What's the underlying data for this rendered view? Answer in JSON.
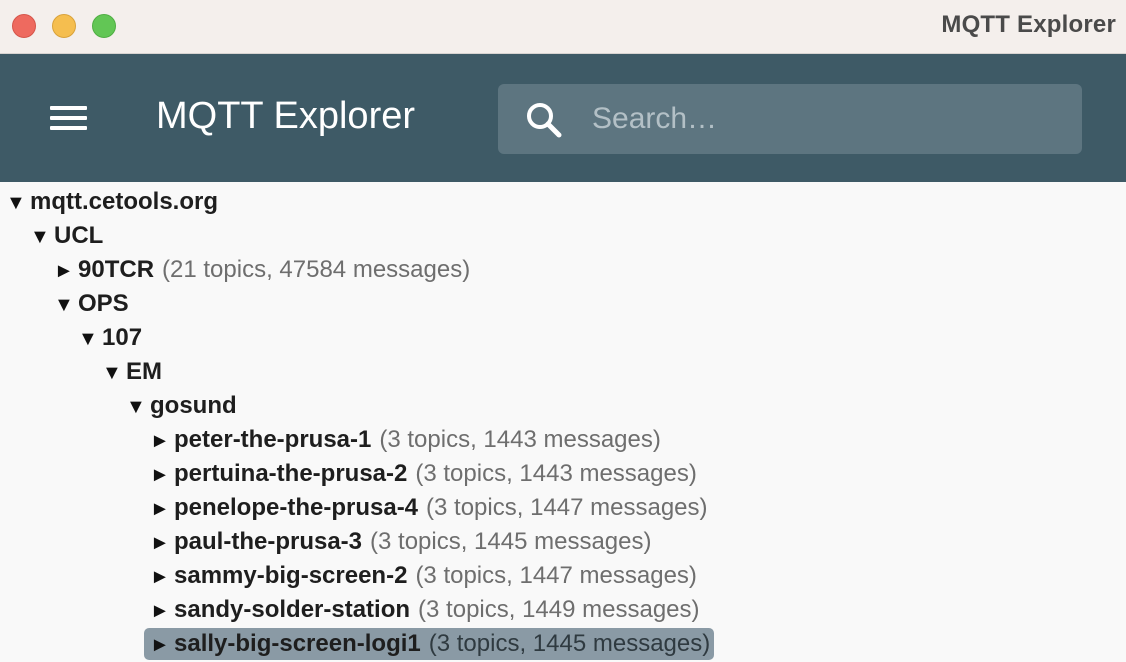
{
  "window": {
    "title": "MQTT Explorer"
  },
  "appbar": {
    "title": "MQTT Explorer",
    "search_placeholder": "Search…"
  },
  "tree": [
    {
      "label": "mqtt.cetools.org",
      "meta": "",
      "expanded": true,
      "selected": false
    },
    {
      "label": "UCL",
      "meta": "",
      "expanded": true,
      "selected": false
    },
    {
      "label": "90TCR",
      "meta": "(21 topics, 47584 messages)",
      "expanded": false,
      "selected": false
    },
    {
      "label": "OPS",
      "meta": "",
      "expanded": true,
      "selected": false
    },
    {
      "label": "107",
      "meta": "",
      "expanded": true,
      "selected": false
    },
    {
      "label": "EM",
      "meta": "",
      "expanded": true,
      "selected": false
    },
    {
      "label": "gosund",
      "meta": "",
      "expanded": true,
      "selected": false
    },
    {
      "label": "peter-the-prusa-1",
      "meta": "(3 topics, 1443 messages)",
      "expanded": false,
      "selected": false
    },
    {
      "label": "pertuina-the-prusa-2",
      "meta": "(3 topics, 1443 messages)",
      "expanded": false,
      "selected": false
    },
    {
      "label": "penelope-the-prusa-4",
      "meta": "(3 topics, 1447 messages)",
      "expanded": false,
      "selected": false
    },
    {
      "label": "paul-the-prusa-3",
      "meta": "(3 topics, 1445 messages)",
      "expanded": false,
      "selected": false
    },
    {
      "label": "sammy-big-screen-2",
      "meta": "(3 topics, 1447 messages)",
      "expanded": false,
      "selected": false
    },
    {
      "label": "sandy-solder-station",
      "meta": "(3 topics, 1449 messages)",
      "expanded": false,
      "selected": false
    },
    {
      "label": "sally-big-screen-logi1",
      "meta": "(3 topics, 1445 messages)",
      "expanded": false,
      "selected": true
    }
  ],
  "icons": {
    "expanded": "▼",
    "collapsed": "►"
  },
  "colors": {
    "appbar": "#3e5a66",
    "selection": "#8a9aa5"
  }
}
